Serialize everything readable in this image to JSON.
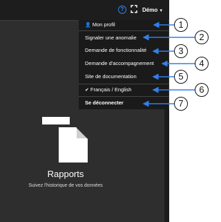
{
  "header": {
    "help_icon_glyph": "?",
    "user_label": "Démo",
    "caret": "▼"
  },
  "dropdown": {
    "items": [
      {
        "label": "Mon profil",
        "icon": "user-icon"
      },
      {
        "label": "Signaler une anomalie"
      },
      {
        "label": "Demande de fonctionnalité"
      },
      {
        "label": "Demande d'accompagnement"
      },
      {
        "label": "Site de documentation"
      },
      {
        "label": "Français / English",
        "icon": "check-icon"
      },
      {
        "label": "Se déconnecter"
      }
    ]
  },
  "main": {
    "title": "Rapports",
    "subtitle": "Suivez l'historique de vos données"
  },
  "callouts": [
    "1",
    "2",
    "3",
    "4",
    "5",
    "6",
    "7"
  ],
  "colors": {
    "accent": "#2f80ed",
    "topbar": "#1d1d1d",
    "content_bg": "#2e2e2e",
    "menu_bg": "#1a1a1a"
  }
}
